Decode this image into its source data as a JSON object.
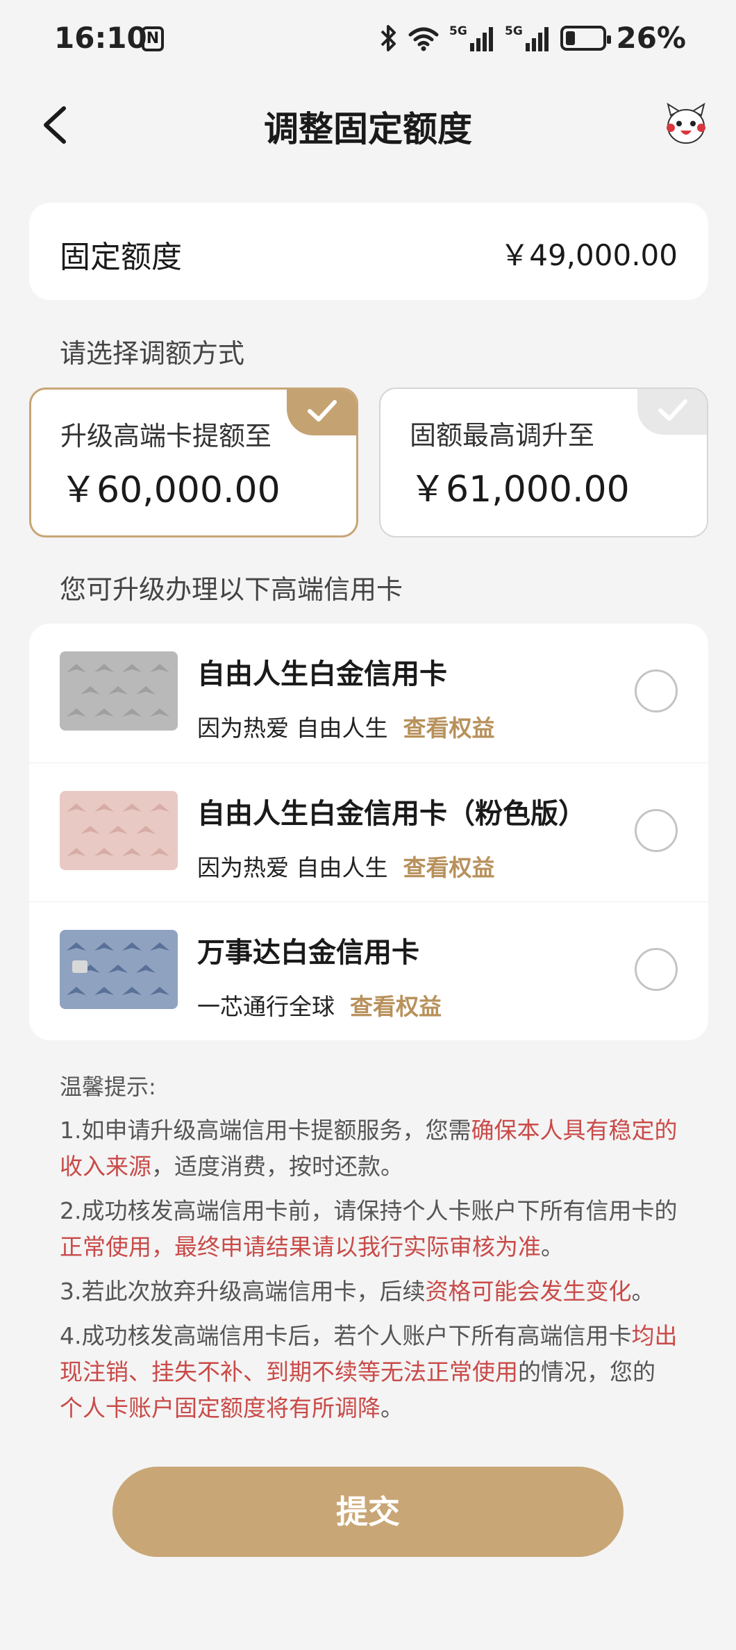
{
  "status_bar": {
    "time": "16:10",
    "battery": "26%",
    "battery_level": 0.26,
    "network_1": "5G",
    "network_2": "5G"
  },
  "nav": {
    "title": "调整固定额度"
  },
  "limit": {
    "label": "固定额度",
    "value": "￥49,000.00"
  },
  "method_label": "请选择调额方式",
  "options": [
    {
      "title": "升级高端卡提额至",
      "value": "￥60,000.00",
      "selected": true
    },
    {
      "title": "固额最高调升至",
      "value": "￥61,000.00",
      "selected": false
    }
  ],
  "cards_label": "您可升级办理以下高端信用卡",
  "cards": [
    {
      "name": "自由人生白金信用卡",
      "desc": "因为热爱 自由人生",
      "link": "查看权益",
      "color": "#b9b9b9"
    },
    {
      "name": "自由人生白金信用卡（粉色版）",
      "desc": "因为热爱 自由人生",
      "link": "查看权益",
      "color": "#e8c9c3"
    },
    {
      "name": "万事达白金信用卡",
      "desc": "一芯通行全球",
      "link": "查看权益",
      "color": "#8fa2c0"
    }
  ],
  "tips": {
    "title": "温馨提示:",
    "t1a": "1.如申请升级高端信用卡提额服务，您需",
    "t1b": "确保本人具有稳定的收入来源",
    "t1c": "，适度消费，按时还款。",
    "t2a": "2.成功核发高端信用卡前，请保持个人卡账户下所有信用卡的",
    "t2b": "正常使用，最终申请结果请以我行实际审核为准",
    "t2c": "。",
    "t3a": "3.若此次放弃升级高端信用卡，后续",
    "t3b": "资格可能会发生变化",
    "t3c": "。",
    "t4a": "4.成功核发高端信用卡后，若个人账户下所有高端信用卡",
    "t4b": "均出现注销、挂失不补、到期不续等无法正常使用",
    "t4c": "的情况，您的",
    "t4d": "个人卡账户固定额度将有所调降",
    "t4e": "。"
  },
  "submit_label": "提交",
  "colors": {
    "accent": "#c9a676",
    "link": "#b8915c",
    "warning_red": "#c94a48",
    "background": "#f4f4f4"
  }
}
